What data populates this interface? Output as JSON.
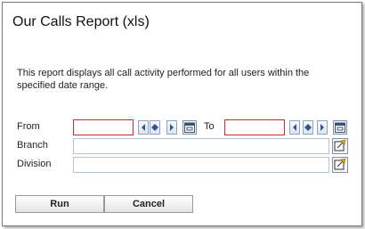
{
  "dialog": {
    "title": "Our Calls Report (xls)",
    "description": "This report displays all call activity performed for all users within the specified date range."
  },
  "form": {
    "from_label": "From",
    "from_value": "",
    "to_label": "To",
    "to_value": "",
    "branch_label": "Branch",
    "branch_value": "",
    "division_label": "Division",
    "division_value": ""
  },
  "buttons": {
    "run_label": "Run",
    "cancel_label": "Cancel"
  },
  "icons": {
    "prev": "triangle-left-icon",
    "today": "diamond-icon",
    "next": "triangle-right-icon",
    "calendar": "calendar-icon",
    "picker": "edit-picker-icon"
  },
  "colors": {
    "required_border": "#cc2b2b",
    "field_border": "#b8c4d6",
    "nav_blue": "#2f5597"
  }
}
